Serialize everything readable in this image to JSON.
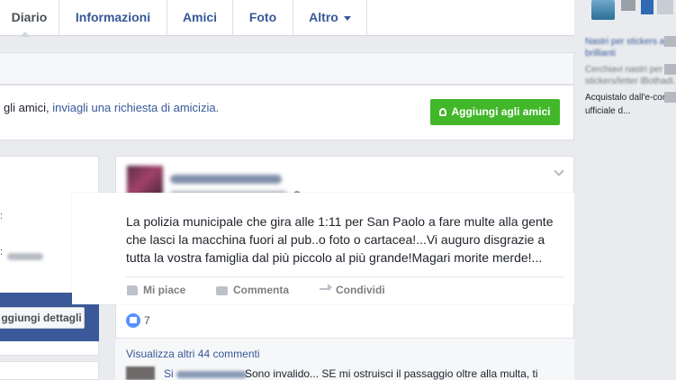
{
  "nav": {
    "tabs": [
      {
        "label": "Diario",
        "active": true
      },
      {
        "label": "Informazioni"
      },
      {
        "label": "Amici"
      },
      {
        "label": "Foto"
      },
      {
        "label": "Altro"
      }
    ]
  },
  "friend_request": {
    "text_prefix": "gli amici,",
    "link_text": "inviagli una richiesta di amicizia.",
    "button_label": "Aggiungi agli amici",
    "button_icon": "add-friend-icon"
  },
  "left_card": {
    "details_button": "ggiungi dettagli"
  },
  "post": {
    "text_lines": [
      "La polizia municipale che gira alle 1:11 per San Paolo a fare multe alla gente",
      "che lasci la macchina fuori al pub..o foto o cartacea!...Vi auguro disgrazie a",
      "tutta la vostra famiglia dal più piccolo al più grande!Magari morite merde!..."
    ],
    "actions": {
      "like": "Mi piace",
      "comment": "Commenta",
      "share": "Condividi"
    },
    "like_count": "7",
    "more_comments": "Visualizza altri 44 commenti",
    "comment_name_initial": "Si",
    "comment_text": "Sono invalido... SE mi ostruisci il passaggio oltre alla multa, ti"
  },
  "sidebar_ad": {
    "blurred_lines": [
      "Nastri per stickers ai",
      "brillianti",
      "Cerchiavi nastri per",
      "stickers/letter lBothadi..."
    ],
    "lines": [
      "Acquistalo dall'e-com",
      "ufficiale d..."
    ]
  },
  "colors": {
    "link": "#365899",
    "green_button": "#42b72a",
    "like_badge": "#5890ff",
    "left_band": "#3b5998"
  }
}
